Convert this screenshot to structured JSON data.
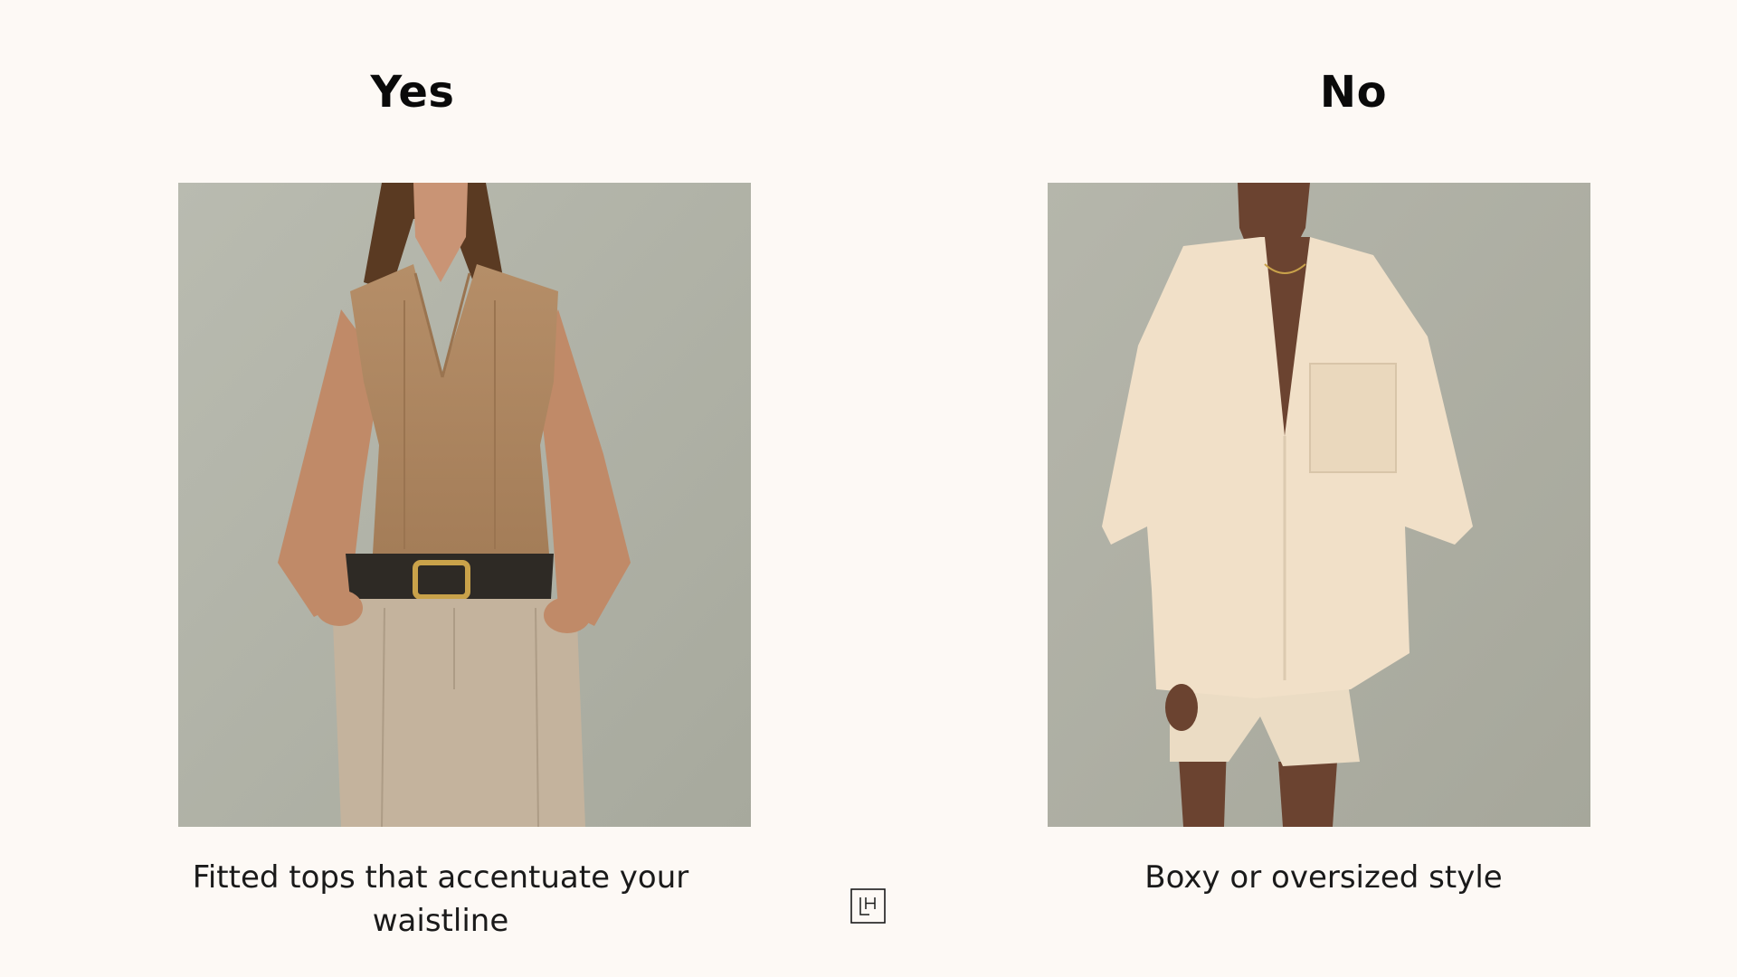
{
  "comparison": {
    "yes": {
      "heading": "Yes",
      "caption": "Fitted tops that accentuate your waistline",
      "photo": "model-fitted-sleeveless-top-belted-trousers"
    },
    "no": {
      "heading": "No",
      "caption": "Boxy or oversized style",
      "photo": "model-oversized-linen-shirt-shorts"
    }
  },
  "brand": {
    "logo_text": "LH",
    "logo_icon": "lh-monogram-icon"
  },
  "colors": {
    "background": "#fdf9f5",
    "text": "#1a1a1a",
    "photo_backdrop": "#b8baae"
  }
}
